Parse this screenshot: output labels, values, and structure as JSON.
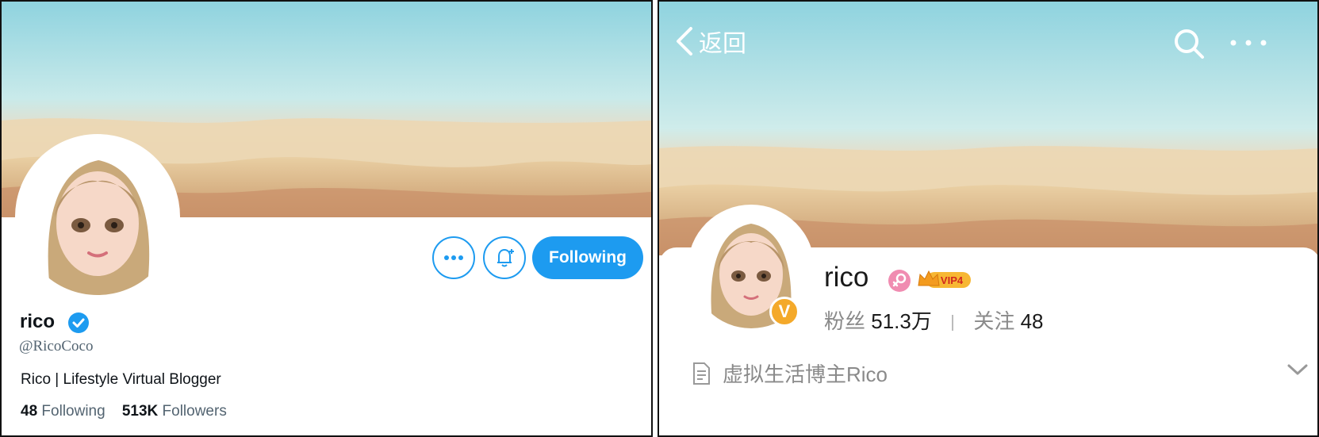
{
  "twitter": {
    "name": "rico",
    "handle": "@RicoCoco",
    "bio": "Rico | Lifestyle Virtual Blogger",
    "following_count": "48",
    "following_label": "Following",
    "followers_count": "513K",
    "followers_label": "Followers",
    "follow_button_label": "Following",
    "accent_color": "#1d9bf0",
    "icons": [
      "more-icon",
      "notification-bell-icon",
      "verified-icon"
    ]
  },
  "weibo": {
    "back_label": "返回",
    "name": "rico",
    "vip_label": "VIP4",
    "fans_label": "粉丝",
    "fans_count": "51.3万",
    "follow_label": "关注",
    "follow_count": "48",
    "bio": "虚拟生活博主Rico",
    "verified_badge": "V",
    "icons": [
      "back-chevron-icon",
      "search-icon",
      "more-icon",
      "female-icon",
      "crown-icon",
      "document-icon",
      "chevron-down-icon"
    ]
  }
}
